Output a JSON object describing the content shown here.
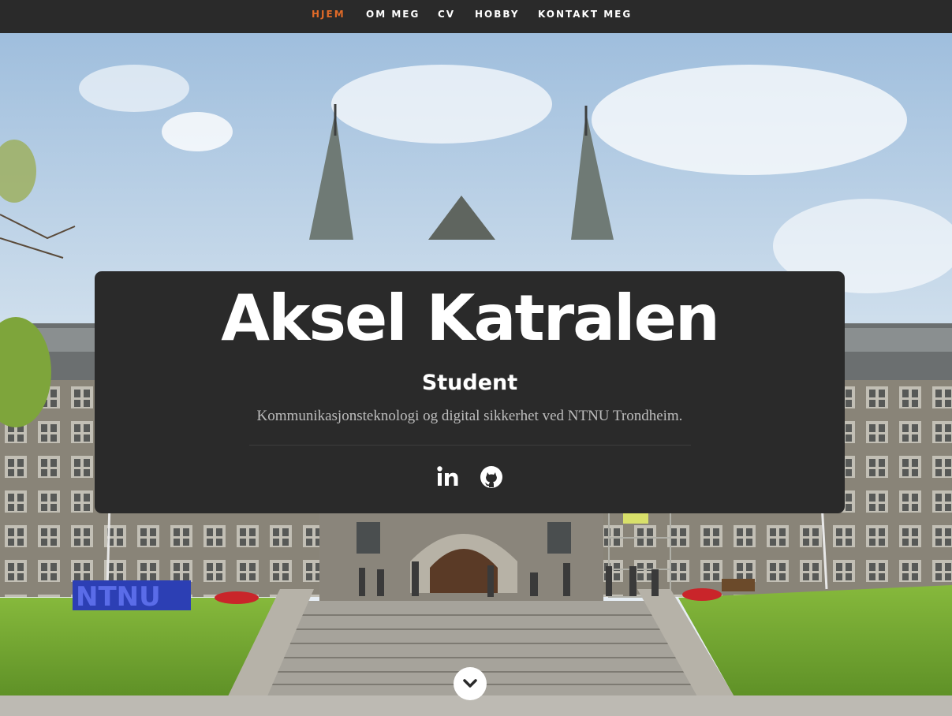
{
  "nav": {
    "items": [
      {
        "label": "HJEM",
        "active": true
      },
      {
        "label": "OM MEG",
        "active": false
      },
      {
        "label": "CV",
        "active": false
      },
      {
        "label": "HOBBY",
        "active": false
      },
      {
        "label": "KONTAKT MEG",
        "active": false
      }
    ]
  },
  "hero": {
    "name": "Aksel Katralen",
    "role": "Student",
    "description": "Kommunikasjonsteknologi og digital sikkerhet ved NTNU Trondheim.",
    "sign_text": "NTNU",
    "social": [
      {
        "icon": "linkedin-icon"
      },
      {
        "icon": "github-icon"
      }
    ],
    "scroll_icon": "chevron-down-icon"
  },
  "colors": {
    "navbar_bg": "#2a2a2a",
    "accent": "#e06a28",
    "card_bg": "#2a2a2a",
    "text": "#ffffff",
    "muted_text": "#bdbdbd"
  }
}
